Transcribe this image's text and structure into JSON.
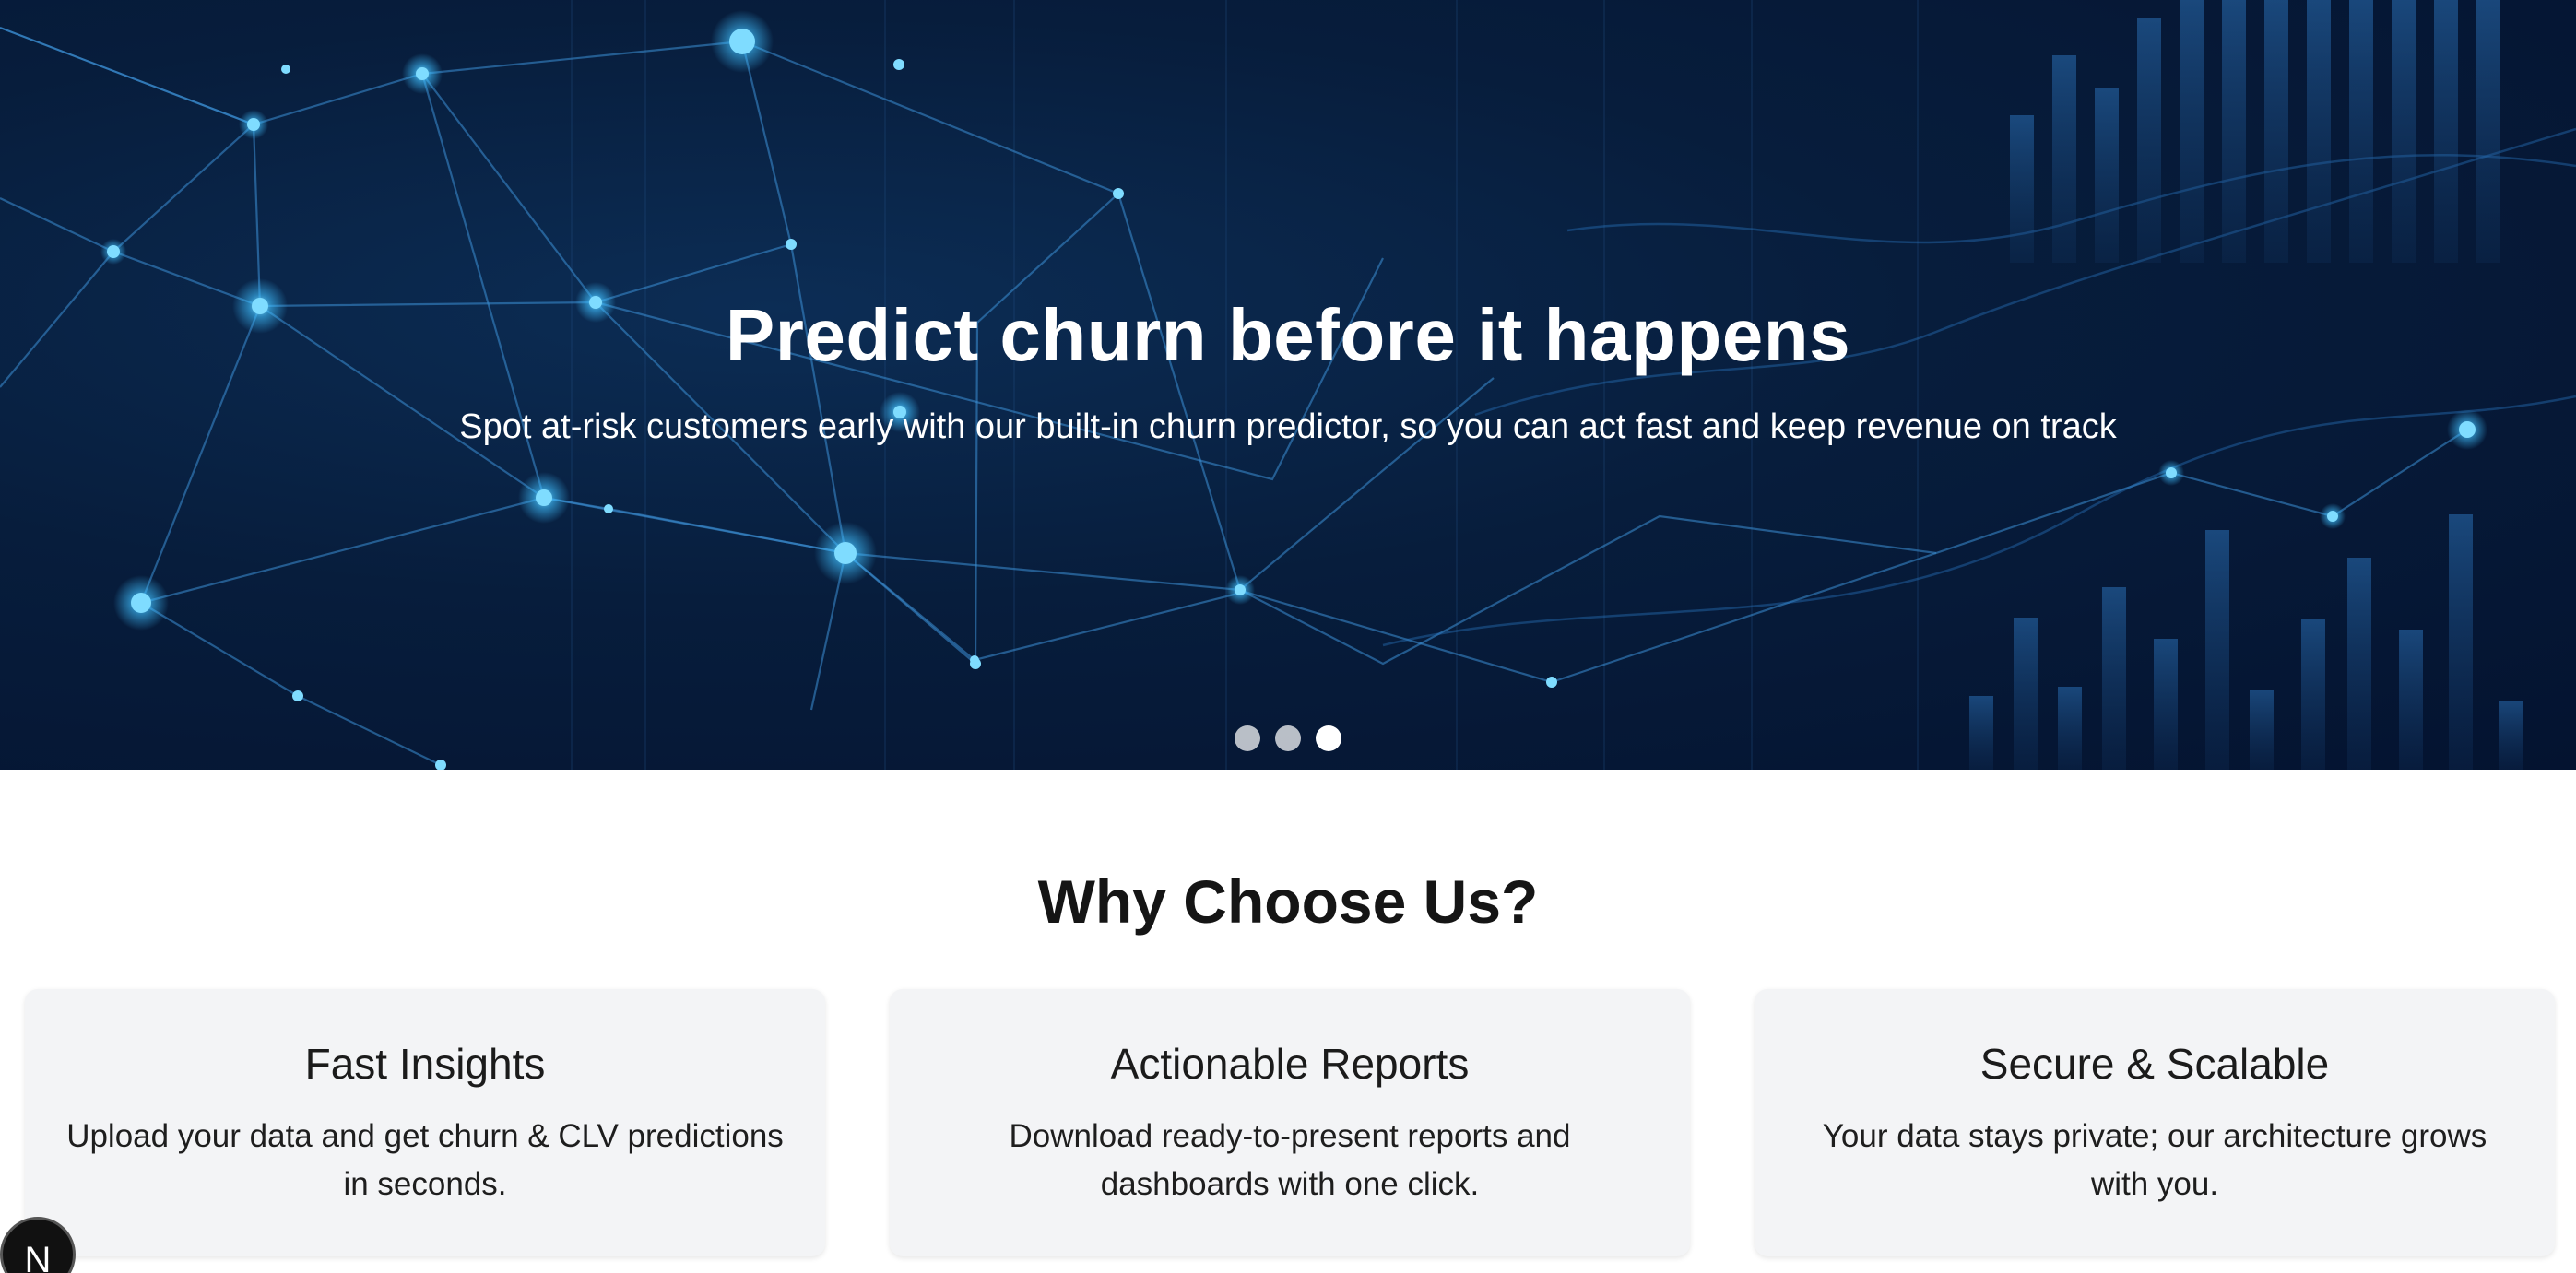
{
  "hero": {
    "title": "Predict churn before it happens",
    "subtitle": "Spot at-risk customers early with our built-in churn predictor, so you can act fast and keep revenue on track",
    "slides": [
      {
        "active": false
      },
      {
        "active": false
      },
      {
        "active": true
      }
    ]
  },
  "why": {
    "title": "Why Choose Us?",
    "cards": [
      {
        "title": "Fast Insights",
        "text": "Upload your data and get churn & CLV predictions in seconds."
      },
      {
        "title": "Actionable Reports",
        "text": "Download ready-to-present reports and dashboards with one click."
      },
      {
        "title": "Secure & Scalable",
        "text": "Your data stays private; our architecture grows with you."
      }
    ]
  },
  "badge": {
    "label": "N"
  },
  "colors": {
    "hero_bg": "#071d3c",
    "node_glow": "#5fd4ff",
    "card_bg": "#f3f4f6"
  }
}
